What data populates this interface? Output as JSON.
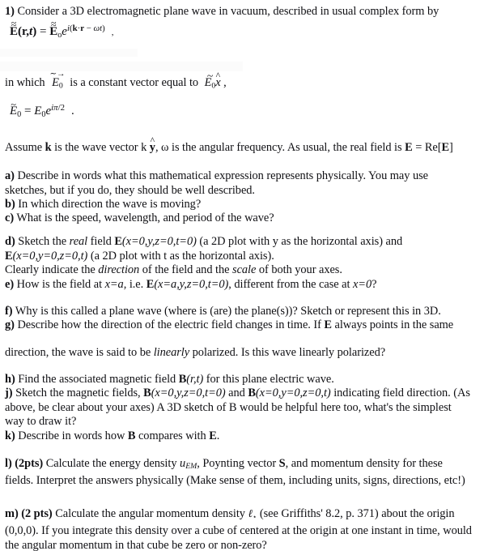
{
  "document": {
    "type": "physics-homework-problem",
    "background_color": "#ffffff",
    "text_color": "#101014"
  },
  "problem": {
    "number_label": "1)",
    "intro_line": "Consider a 3D electromagnetic plane wave in vacuum, described in usual complex form by",
    "equation_1": {
      "lhs_field": "E",
      "lhs_args": "(r,t)",
      "equals": "=",
      "rhs_field": "E",
      "rhs_subscript": "o",
      "exponential_base": "e",
      "exponent": "i(k·r − ωt)",
      "trailing_punctuation": ",",
      "plain_text": "E(r,t) = E_o e^{i(k·r − ωt)} ,"
    },
    "in_which_prefix": "in which",
    "in_which_symbol": "E_0",
    "in_which_middle": "is a constant vector equal to",
    "in_which_value": "E_0 x̂",
    "in_which_trailing": ",",
    "equation_2": {
      "plain_text": "E_0 = E_0 e^{iπ/2} .",
      "lhs": "E",
      "lhs_subscript": "0",
      "equals": "=",
      "rhs": "E",
      "rhs_subscript": "0",
      "exponential_base": "e",
      "exponent": "iπ/2",
      "trailing_punctuation": "."
    },
    "assume_line": {
      "plain_text": "Assume k is the wave vector k ŷ, ω is the angular frequency. As usual, the real field is E = Re[E]",
      "seg_1": "Assume ",
      "seg_2": "k",
      "seg_3": " is the wave vector k ",
      "seg_4": "ŷ",
      "seg_5": ", ω is the angular frequency. As usual, the real field is ",
      "seg_6": "E",
      "seg_7": " = Re[",
      "seg_8": "E",
      "seg_9": "]"
    }
  },
  "parts": [
    {
      "id": "a",
      "label": "a)",
      "lines": [
        "Describe in words what this mathematical expression represents physically. You may use",
        "sketches, but if you do, they should be well described."
      ]
    },
    {
      "id": "b",
      "label": "b)",
      "lines": [
        "In which direction the wave is moving?"
      ]
    },
    {
      "id": "c",
      "label": "c)",
      "lines": [
        "What is the speed, wavelength, and period of the wave?"
      ]
    },
    {
      "id": "d",
      "label": "d)",
      "lines": [
        "Sketch the real field E(x=0,y,z=0,t=0) (a 2D plot with y as the horizontal axis) and",
        "E(x=0,y=0,z=0,t) (a 2D plot with t as the horizontal axis).",
        "Clearly indicate the direction of the field and the scale of both your axes."
      ]
    },
    {
      "id": "e",
      "label": "e)",
      "lines": [
        "How is the field at x=a, i.e. E(x=a,y,z=0,t=0), different from the case at x=0?"
      ]
    },
    {
      "id": "f",
      "label": "f)",
      "lines": [
        "Why is this called a plane wave (where is (are) the plane(s))? Sketch or represent this in 3D."
      ]
    },
    {
      "id": "g",
      "label": "g)",
      "lines": [
        "Describe how the direction of the electric field changes in time. If E always points in the same",
        "direction, the wave is said to be linearly polarized. Is this wave linearly polarized?"
      ]
    },
    {
      "id": "h",
      "label": "h)",
      "lines": [
        "Find the associated magnetic field B(r,t) for this plane electric wave."
      ]
    },
    {
      "id": "j",
      "label": "j)",
      "lines": [
        "Sketch the magnetic fields, B(x=0,y,z=0,t=0) and B(x=0,y=0,z=0,t) indicating field direction. (As",
        "above, be clear about your axes) A 3D sketch of B would be helpful here too, what's the simplest",
        "way to draw it?"
      ]
    },
    {
      "id": "k",
      "label": "k)",
      "lines": [
        "Describe in words how B compares with E."
      ]
    },
    {
      "id": "l",
      "label": "l)",
      "points": "(2pts)",
      "lines": [
        "Calculate the energy density uEM, Poynting vector S, and momentum density for these",
        "fields. Interpret the answers physically (Make sense of them, including units, signs, directions, etc!)"
      ]
    },
    {
      "id": "m",
      "label": "m)",
      "points": "(2 pts)",
      "lines": [
        "Calculate the angular momentum density ℓ (see Griffiths' 8.2, p. 371) about the origin",
        "(0,0,0). If you integrate this density over a cube of centered at the origin at one instant in time, would",
        "the angular momentum in that cube be zero or non-zero?"
      ]
    }
  ],
  "text_fragments": {
    "a_l1_a": "Describe in words what this mathematical expression represents physically. You may use",
    "a_l2": "sketches, but if you do, they should be well described.",
    "b_l1": "In which direction the wave is moving?",
    "c_l1": "What is the speed, wavelength, and period of the wave?",
    "d_pre": "Sketch the ",
    "d_real": "real",
    "d_mid": " field ",
    "d_E1": "E",
    "d_args1": "(x=0,y,z=0,t=0)",
    "d_tail1": " (a 2D plot with y as the horizontal axis) and",
    "d_E2": "E",
    "d_args2": "(x=0,y=0,z=0,t)",
    "d_tail2": " (a 2D plot with t as the horizontal axis).",
    "d_l3_a": "Clearly indicate the ",
    "d_direction": "direction",
    "d_l3_b": " of the field and the ",
    "d_scale": "scale",
    "d_l3_c": " of both your axes.",
    "e_a": "How is the field at ",
    "e_xa": "x=a",
    "e_b": ", i.e. ",
    "e_E": "E",
    "e_args": "(x=a,y,z=0,t=0)",
    "e_c": ", different from the case at ",
    "e_x0": "x=0",
    "e_d": "?",
    "f_l1": "Why is this called a plane wave (where is (are) the plane(s))? Sketch or represent this in 3D.",
    "g_a": "Describe how the direction of the electric field changes in time. If ",
    "g_E": "E",
    "g_b": " always points in the same",
    "g_l2_a": "direction, the wave is said to be ",
    "g_linearly": "linearly",
    "g_l2_b": " polarized. Is this wave linearly polarized?",
    "h_a": "Find the associated magnetic field ",
    "h_B": "B",
    "h_args": "(r,t)",
    "h_b": " for this plane electric wave.",
    "j_a": "Sketch the magnetic fields, ",
    "j_B1": "B",
    "j_args1": "(x=0,y,z=0,t=0)",
    "j_b": " and ",
    "j_B2": "B",
    "j_args2": "(x=0,y=0,z=0,t)",
    "j_c": " indicating field direction. (As",
    "j_l2": "above, be clear about your axes) A 3D sketch of B would be helpful here too, what's the simplest",
    "j_l3": "way to draw it?",
    "k_a": "Describe in words how ",
    "k_B": "B",
    "k_b": " compares with ",
    "k_E": "E",
    "k_c": ".",
    "l_pts": "(2pts)",
    "l_a": " Calculate the energy density ",
    "l_u": "u",
    "l_EM": "EM",
    "l_b": ", Poynting vector ",
    "l_S": "S",
    "l_c": ", and momentum density for these",
    "l_l2": "fields. Interpret the answers physically (Make sense of them, including units, signs, directions, etc!)",
    "m_pts": "(2 pts)",
    "m_a": " Calculate the angular momentum density ",
    "m_ell": "ℓ",
    "m_b": " (see Griffiths' 8.2, p. 371) about the origin",
    "m_l2": "(0,0,0). If you integrate this density over a cube of centered at the origin at one instant in time, would",
    "m_l3": "the angular momentum in that cube be zero or non-zero?"
  },
  "symbols": {
    "tilde": "~",
    "hat": "^",
    "arrow": "→",
    "omega": "ω",
    "pi": "π",
    "dot": "·",
    "minus": "−",
    "ell_script": "ℓ",
    "y_hat": "ŷ",
    "x_hat": "x̂"
  }
}
